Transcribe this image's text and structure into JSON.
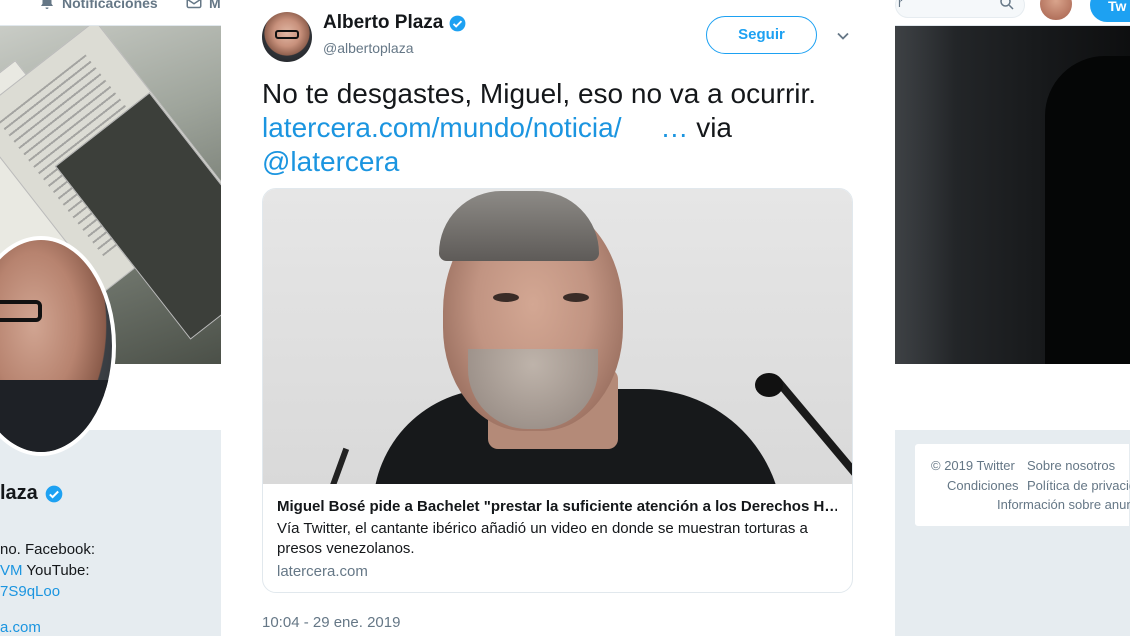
{
  "topnav": {
    "notifications_label": "Notificaciones",
    "second_label": "M",
    "search_partial": "r",
    "tweet_button_partial": "Tw"
  },
  "profile": {
    "name_partial": "laza",
    "bio_line1": "no. Facebook:",
    "bio_line2_link": "VM",
    "bio_line2_text": "YouTube:",
    "bio_line3": "7S9qLoo",
    "website_partial": "a.com"
  },
  "footer": {
    "copyright": "© 2019 Twitter",
    "about": "Sobre nosotros",
    "conditions": "Condiciones",
    "privacy": "Política de privacid",
    "ads_info": "Información sobre anun"
  },
  "tweet": {
    "author_name": "Alberto Plaza",
    "author_handle": "@albertoplaza",
    "follow_label": "Seguir",
    "text_main": "No te desgastes, Miguel, eso no va a ocurrir.",
    "link_text": "latercera.com/mundo/noticia/",
    "ellipsis": "…",
    "via_text": "via",
    "mention": "@latercera",
    "card": {
      "title": "Miguel Bosé pide a Bachelet \"prestar la suficiente atención a los Derechos H…",
      "description": "Vía Twitter, el cantante ibérico añadió un video en donde se muestran torturas a presos venezolanos.",
      "domain": "latercera.com"
    },
    "timestamp": "10:04 - 29 ene. 2019"
  },
  "colors": {
    "brand_blue": "#1da1f2",
    "link_blue": "#1b95e0",
    "secondary_text": "#657786",
    "page_bg": "#e6ecf0"
  }
}
